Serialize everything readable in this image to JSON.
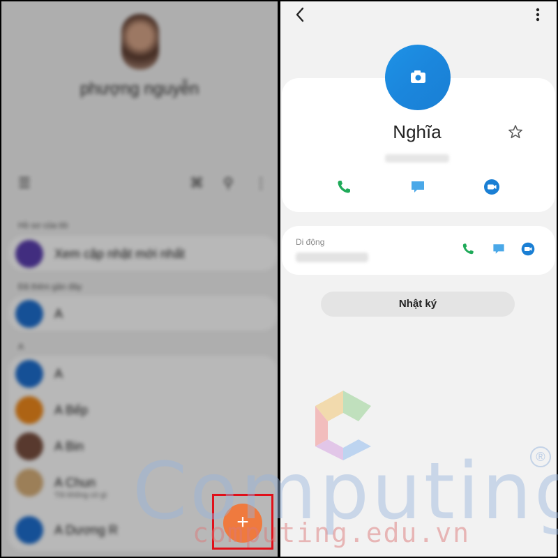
{
  "left_panel": {
    "profile_name": "phượng nguyễn",
    "sections": {
      "me": "Hồ sơ của tôi",
      "favorites": "Đã thêm gần đây",
      "alpha": "A"
    },
    "rows": [
      {
        "name": "Xem cập nhật mới nhất",
        "avatar_color": "#5b3fb0"
      },
      {
        "name": "A",
        "avatar_color": "#1e6fd0"
      },
      {
        "name": "A",
        "avatar_color": "#1e6fd0"
      },
      {
        "name": "A Bếp",
        "avatar_color": "#f08a1c"
      },
      {
        "name": "A Bin",
        "avatar_color": "#7a5040"
      },
      {
        "name": "A Chun",
        "sub": "Tôi không có gì",
        "avatar_color": "#d8b07a"
      },
      {
        "name": "A Dương R",
        "avatar_color": "#1e6fd0"
      }
    ],
    "fab_label": "+"
  },
  "right_panel": {
    "contact_name": "Nghĩa",
    "mobile_label": "Di động",
    "log_button": "Nhật ký",
    "accent_green": "#1faa59",
    "accent_blue": "#1a7fd4"
  },
  "watermark": {
    "brand": "Computing",
    "url": "computing.edu.vn",
    "registered": "®"
  }
}
